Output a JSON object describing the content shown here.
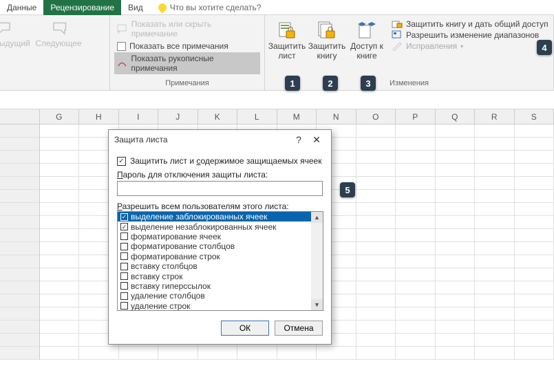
{
  "tabs": {
    "data": "Данные",
    "review": "Рецензирование",
    "view": "Вид"
  },
  "tellme": "Что вы хотите сделать?",
  "nav": {
    "prev": "Предыдущий",
    "next": "Следующее"
  },
  "comments": {
    "showhide": "Показать или скрыть примечание",
    "showall": "Показать все примечания",
    "ink": "Показать рукописные примечания",
    "group": "Примечания"
  },
  "changes": {
    "protect_sheet": "Защитить лист",
    "protect_book": "Защитить книгу",
    "share_book": "Доступ к книге",
    "protect_share": "Защитить книгу и дать общий доступ",
    "allow_ranges": "Разрешить изменение диапазонов",
    "track": "Исправления",
    "group": "Изменения"
  },
  "columns": [
    "",
    "G",
    "H",
    "I",
    "J",
    "K",
    "L",
    "M",
    "N",
    "O",
    "P",
    "Q",
    "R",
    "S"
  ],
  "callouts": {
    "c1": "1",
    "c2": "2",
    "c3": "3",
    "c4": "4",
    "c5": "5"
  },
  "dialog": {
    "title": "Защита листа",
    "protect_cb": "Защитить лист и содержимое защищаемых ячеек",
    "pwd_label": "Пароль для отключения защиты листа:",
    "pwd_value": "",
    "list_label": "Разрешить всем пользователям этого листа:",
    "items": [
      {
        "label": "выделение заблокированных ячеек",
        "checked": true,
        "selected": true
      },
      {
        "label": "выделение незаблокированных ячеек",
        "checked": true,
        "selected": false
      },
      {
        "label": "форматирование ячеек",
        "checked": false,
        "selected": false
      },
      {
        "label": "форматирование столбцов",
        "checked": false,
        "selected": false
      },
      {
        "label": "форматирование строк",
        "checked": false,
        "selected": false
      },
      {
        "label": "вставку столбцов",
        "checked": false,
        "selected": false
      },
      {
        "label": "вставку строк",
        "checked": false,
        "selected": false
      },
      {
        "label": "вставку гиперссылок",
        "checked": false,
        "selected": false
      },
      {
        "label": "удаление столбцов",
        "checked": false,
        "selected": false
      },
      {
        "label": "удаление строк",
        "checked": false,
        "selected": false
      }
    ],
    "ok": "ОК",
    "cancel": "Отмена"
  }
}
